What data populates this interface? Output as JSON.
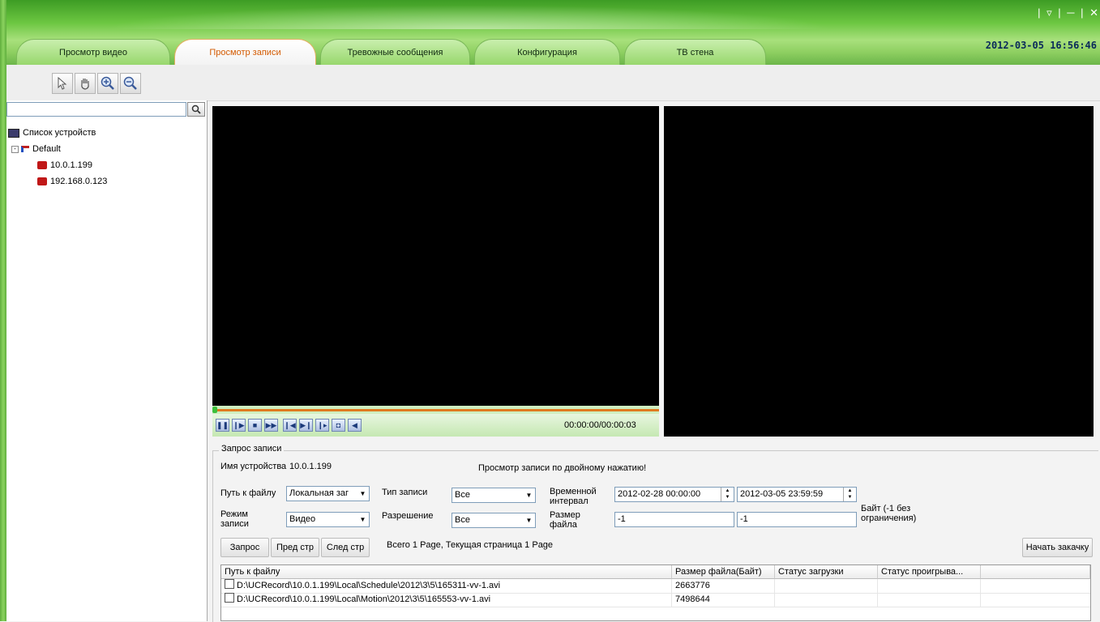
{
  "window": {
    "controls": "| ▿ | ─ | ✕",
    "datetime": "2012-03-05 16:56:46"
  },
  "tabs": [
    {
      "label": "Просмотр видео"
    },
    {
      "label": "Просмотр записи"
    },
    {
      "label": "Тревожные сообщения"
    },
    {
      "label": "Конфигурация"
    },
    {
      "label": "ТВ стена"
    }
  ],
  "toolbar": {
    "icons": [
      "pointer-icon",
      "hand-icon",
      "zoom-in-icon",
      "zoom-out-icon"
    ]
  },
  "sidebar": {
    "search_placeholder": "",
    "tree": {
      "root": "Список устройств",
      "group": "Default",
      "devices": [
        "10.0.1.199",
        "192.168.0.123"
      ]
    }
  },
  "player": {
    "timecode": "00:00:00/00:00:03",
    "progress": 0.0
  },
  "query": {
    "legend": "Запрос записи",
    "device_name_label": "Имя устройства",
    "device_name_value": "10.0.1.199",
    "hint": "Просмотр записи по двойному нажатию!",
    "file_path_label": "Путь к файлу",
    "file_path_value": "Локальная заг",
    "record_type_label": "Тип записи",
    "record_type_value": "Все",
    "time_interval_label": "Временной интервал",
    "time_from": "2012-02-28   00:00:00",
    "time_to": "2012-03-05   23:59:59",
    "record_mode_label": "Режим записи",
    "record_mode_value": "Видео",
    "resolution_label": "Разрешение",
    "resolution_value": "Все",
    "file_size_label": "Размер файла",
    "size_min": "-1",
    "size_max": "-1",
    "bytes_note": "Байт (-1 без ограничения)",
    "btn_query": "Запрос",
    "btn_prev": "Пред стр",
    "btn_next": "След стр",
    "paging": "Всего 1 Page, Текущая страница 1 Page",
    "btn_download": "Начать закачку"
  },
  "table": {
    "columns": [
      "Путь к файлу",
      "Размер файла(Байт)",
      "Статус загрузки",
      "Статус проигрыва..."
    ],
    "rows": [
      {
        "path": "D:\\UCRecord\\10.0.1.199\\Local\\Schedule\\2012\\3\\5\\165311-vv-1.avi",
        "size": "2663776",
        "download": "",
        "playback": ""
      },
      {
        "path": "D:\\UCRecord\\10.0.1.199\\Local\\Motion\\2012\\3\\5\\165553-vv-1.avi",
        "size": "7498644",
        "download": "",
        "playback": ""
      }
    ]
  }
}
